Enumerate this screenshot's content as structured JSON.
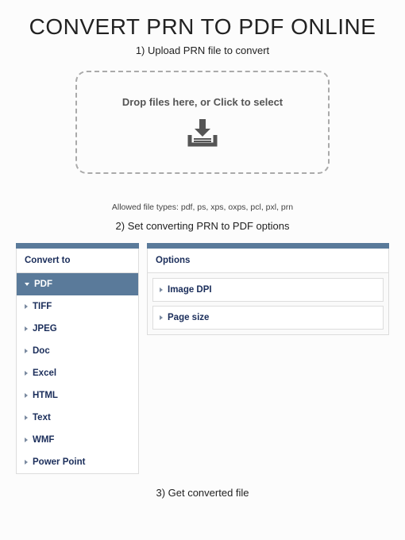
{
  "title": "CONVERT PRN TO PDF ONLINE",
  "steps": {
    "s1": "1) Upload PRN file to convert",
    "s2": "2) Set converting PRN to PDF options",
    "s3": "3) Get converted file"
  },
  "dropzone": {
    "text": "Drop files here, or Click to select"
  },
  "allowed": "Allowed file types: pdf, ps, xps, oxps, pcl, pxl, prn",
  "convert": {
    "header": "Convert to",
    "formats": [
      "PDF",
      "TIFF",
      "JPEG",
      "Doc",
      "Excel",
      "HTML",
      "Text",
      "WMF",
      "Power Point"
    ],
    "selected": "PDF"
  },
  "options": {
    "header": "Options",
    "items": [
      "Image DPI",
      "Page size"
    ]
  }
}
